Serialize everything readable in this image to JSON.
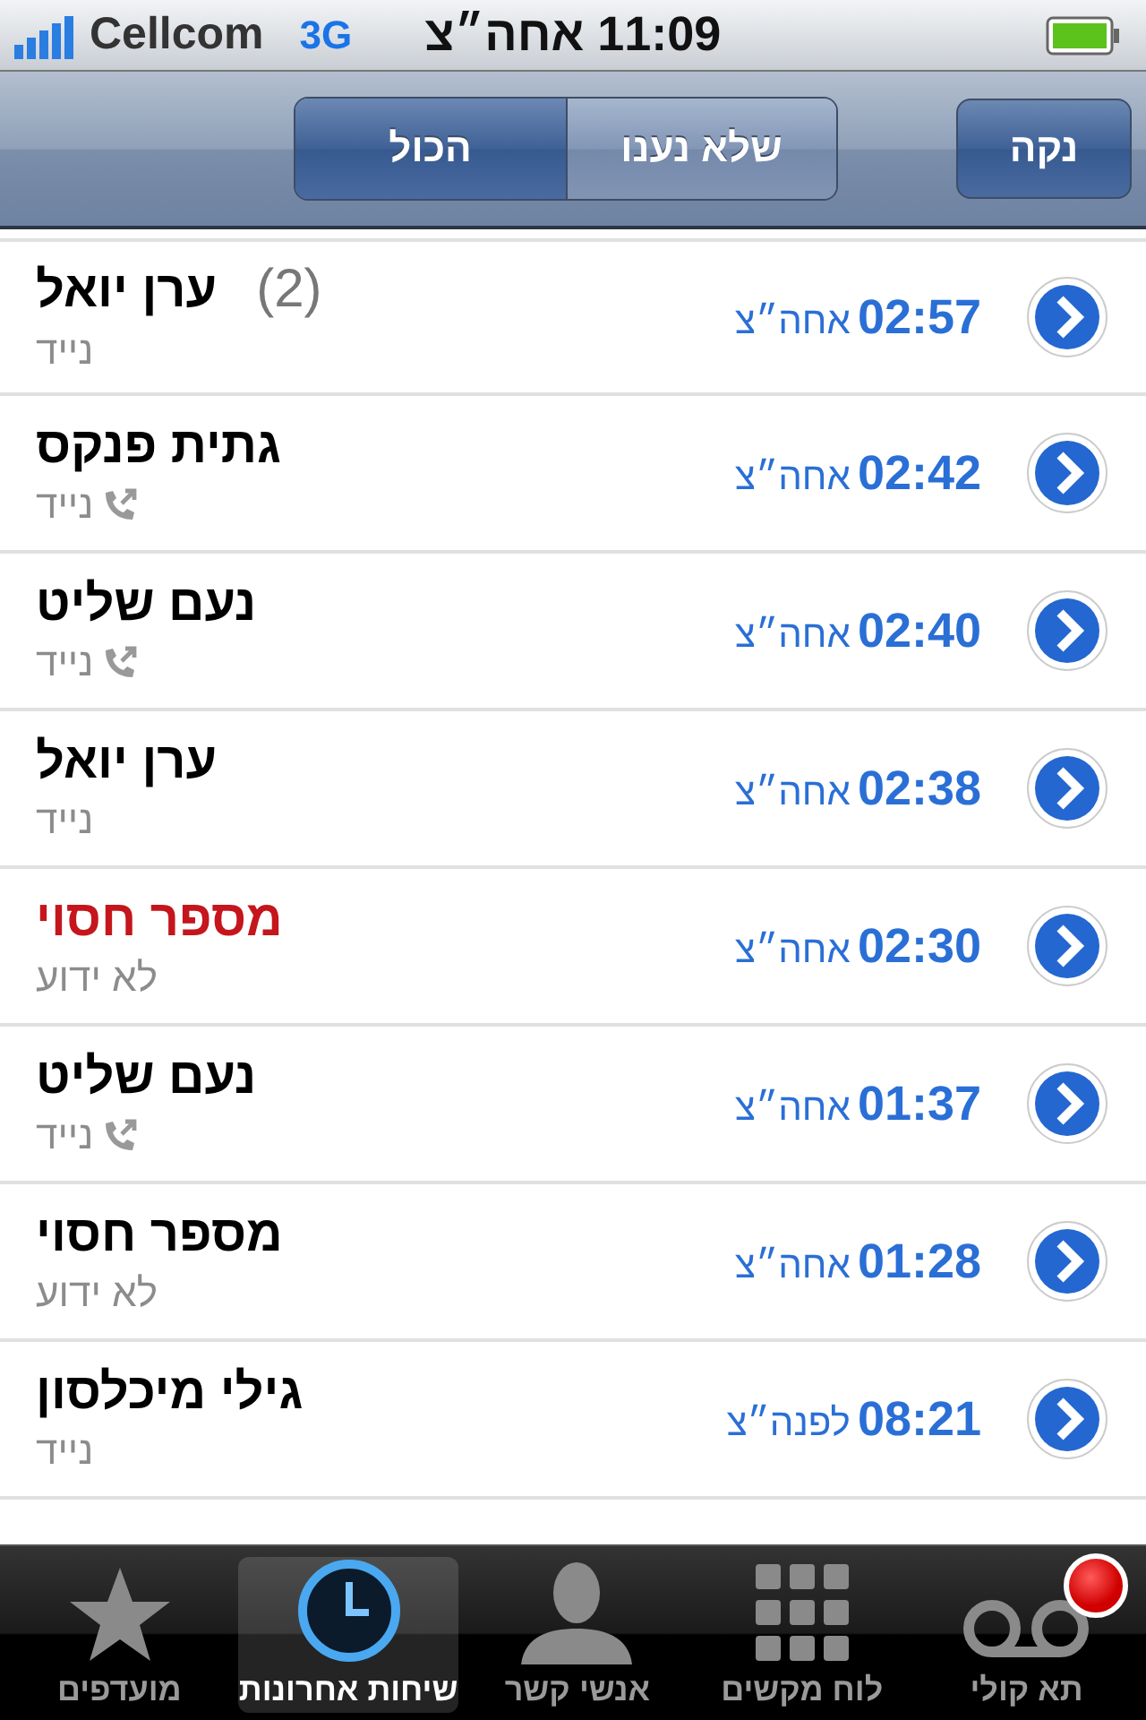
{
  "status_bar": {
    "carrier": "Cellcom",
    "network": "3G",
    "time": "11:09 אחה״צ"
  },
  "nav_bar": {
    "segments": [
      {
        "label": "שלא נענו",
        "selected": false
      },
      {
        "label": "הכול",
        "selected": true
      }
    ],
    "clear_button": "נקה"
  },
  "calls": [
    {
      "name": "ערן יואל",
      "count": "(2)",
      "missed": false,
      "outgoing": false,
      "type": "נייד",
      "time": "02:57",
      "period": "אחה״צ"
    },
    {
      "name": "גתית פנקס",
      "missed": false,
      "outgoing": true,
      "type": "נייד",
      "time": "02:42",
      "period": "אחה״צ"
    },
    {
      "name": "נעם שליט",
      "missed": false,
      "outgoing": true,
      "type": "נייד",
      "time": "02:40",
      "period": "אחה״צ"
    },
    {
      "name": "ערן יואל",
      "missed": false,
      "outgoing": false,
      "type": "נייד",
      "time": "02:38",
      "period": "אחה״צ"
    },
    {
      "name": "מספר חסוי",
      "missed": true,
      "outgoing": false,
      "type": "לא ידוע",
      "time": "02:30",
      "period": "אחה״צ"
    },
    {
      "name": "נעם שליט",
      "missed": false,
      "outgoing": true,
      "type": "נייד",
      "time": "01:37",
      "period": "אחה״צ"
    },
    {
      "name": "מספר חסוי",
      "missed": false,
      "outgoing": false,
      "type": "לא ידוע",
      "time": "01:28",
      "period": "אחה״צ"
    },
    {
      "name": "גילי מיכלסון",
      "missed": false,
      "outgoing": false,
      "type": "נייד",
      "time": "08:21",
      "period": "לפנה״צ"
    }
  ],
  "tab_bar": [
    {
      "kind": "voicemail",
      "label": "תא קולי",
      "selected": false,
      "badge": true
    },
    {
      "kind": "keypad",
      "label": "לוח מקשים",
      "selected": false,
      "badge": false
    },
    {
      "kind": "person",
      "label": "אנשי קשר",
      "selected": false,
      "badge": false
    },
    {
      "kind": "clock",
      "label": "שיחות אחרונות",
      "selected": true,
      "badge": false
    },
    {
      "kind": "star",
      "label": "מועדפים",
      "selected": false,
      "badge": false
    }
  ]
}
